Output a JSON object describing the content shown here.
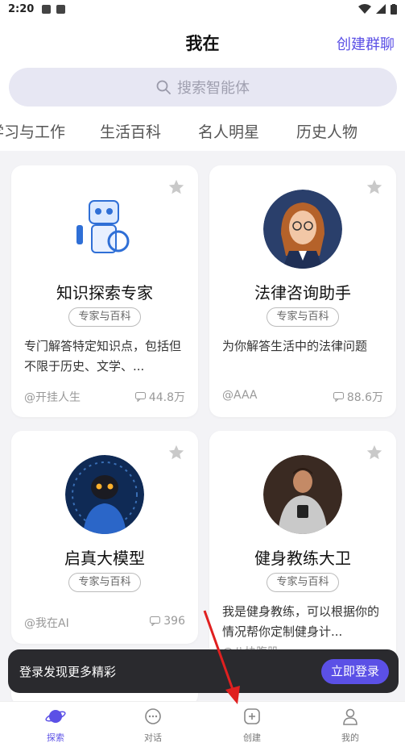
{
  "status_bar": {
    "time": "2:20"
  },
  "header": {
    "title": "我在",
    "create_group": "创建群聊"
  },
  "search": {
    "placeholder": "搜索智能体"
  },
  "tabs": [
    "学习与工作",
    "生活百科",
    "名人明星",
    "历史人物"
  ],
  "cards": [
    {
      "name": "知识探索专家",
      "tag": "专家与百科",
      "desc": "专门解答特定知识点，包括但不限于历史、文学、...",
      "author": "@开挂人生",
      "count": "44.8万"
    },
    {
      "name": "法律咨询助手",
      "tag": "专家与百科",
      "desc": "为你解答生活中的法律问题",
      "author": "@AAA",
      "count": "88.6万"
    },
    {
      "name": "启真大模型",
      "tag": "专家与百科",
      "desc": "",
      "author": "@我在AI",
      "count": "396"
    },
    {
      "name": "健身教练大卫",
      "tag": "专家与百科",
      "desc": "我是健身教练，可以根据你的情况帮你定制健身计...",
      "author": "@八块腹肌",
      "count": ""
    }
  ],
  "toast": {
    "message": "登录发现更多精彩",
    "button": "立即登录"
  },
  "bottom_nav": [
    {
      "label": "探索",
      "icon": "planet-icon",
      "active": true
    },
    {
      "label": "对话",
      "icon": "chat-icon",
      "active": false
    },
    {
      "label": "创建",
      "icon": "plus-square-icon",
      "active": false
    },
    {
      "label": "我的",
      "icon": "person-icon",
      "active": false
    }
  ],
  "colors": {
    "accent": "#5b50e6",
    "toast_bg": "#2a2a2e",
    "search_bg": "#e7e7f3"
  }
}
